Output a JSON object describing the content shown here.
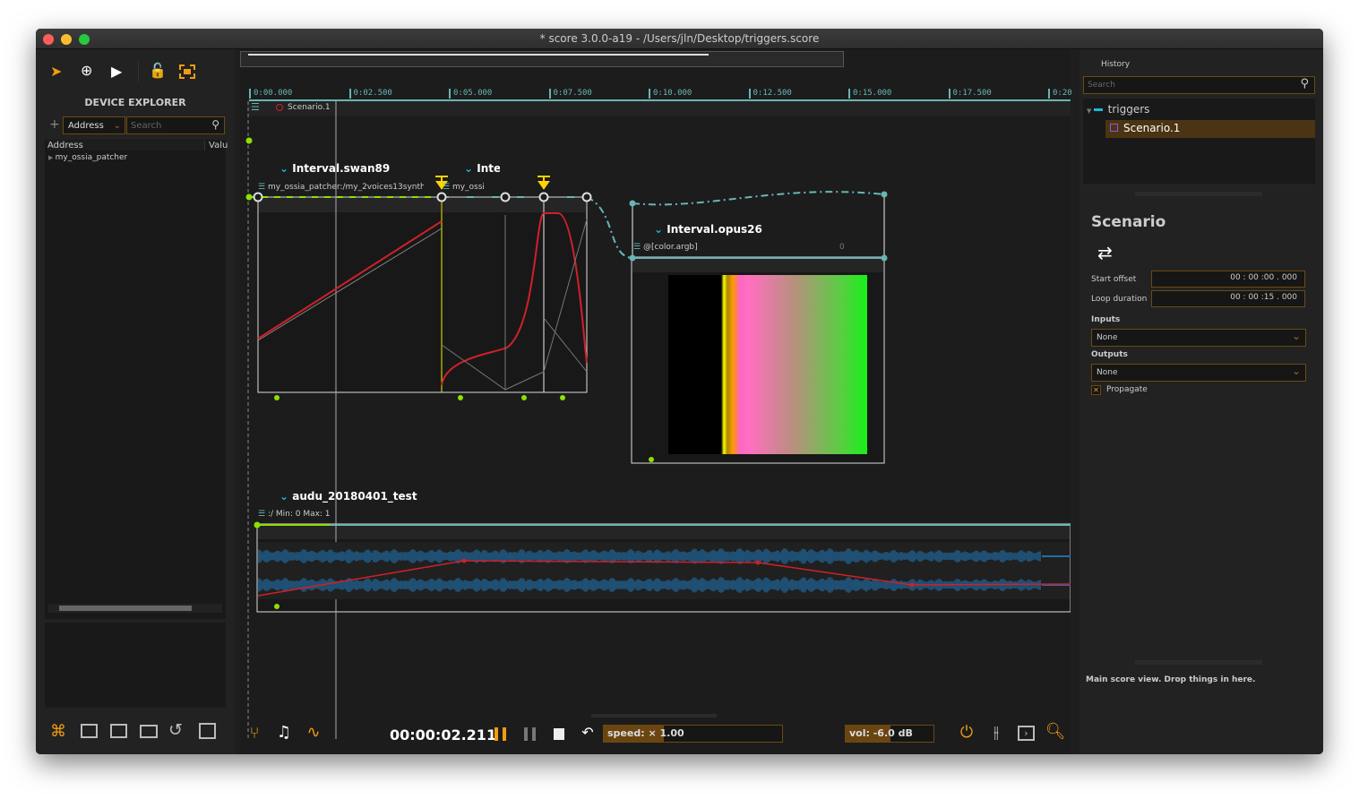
{
  "window": {
    "title": "* score 3.0.0-a19 - /Users/jln/Desktop/triggers.score"
  },
  "left": {
    "toolbar": [
      "select-arrow-icon",
      "add-circle-icon",
      "play-icon",
      "lock-icon",
      "fit-frame-icon"
    ],
    "title": "DEVICE EXPLORER",
    "add": "+",
    "address_select": "Address",
    "search_placeholder": "Search",
    "columns": [
      "Address",
      "Valu"
    ],
    "tree": [
      {
        "label": "my_ossia_patcher"
      }
    ],
    "bottom_icons": [
      "fit-icon",
      "curve-view-icon",
      "device-icon",
      "folder-icon",
      "history-icon",
      "log-icon"
    ]
  },
  "timeline": {
    "ticks": [
      "0:00.000",
      "0:02.500",
      "0:05.000",
      "0:07.500",
      "0:10.000",
      "0:12.500",
      "0:15.000",
      "0:17.500",
      "0:20"
    ],
    "scenario_label": "Scenario.1",
    "intervals": [
      {
        "name": "Interval.swan89",
        "process": "my_ossia_patcher:/my_2voices13synth"
      },
      {
        "name": "Inte",
        "process": "my_ossi"
      },
      {
        "name": "Interval.opus26",
        "process": "@[color.argb]",
        "value": "0"
      },
      {
        "name": "audu_20180401_test",
        "process": ":/ Min: 0 Max: 1"
      }
    ]
  },
  "transport": {
    "time": "00:00:02.211",
    "speed_label": "speed: × 1.00",
    "speed": 1.0,
    "volume_label": "vol: -6.0 dB",
    "volume_db": -6.0
  },
  "right": {
    "history_title": "History",
    "search_placeholder": "Search",
    "tree": {
      "root": "triggers",
      "child": "Scenario.1"
    },
    "inspector": {
      "title": "Scenario",
      "start_offset_label": "Start offset",
      "start_offset": "00 : 00 :00 .   000",
      "loop_duration_label": "Loop duration",
      "loop_duration": "00 : 00 :15 .   000",
      "inputs_label": "Inputs",
      "inputs_value": "None",
      "outputs_label": "Outputs",
      "outputs_value": "None",
      "propagate_label": "Propagate",
      "propagate": true
    },
    "status": "Main score view. Drop things in here."
  },
  "colors": {
    "accent": "#f39c12",
    "teal": "#69b5b5",
    "green": "#8ee000",
    "automation": "#d0202a",
    "waveform": "#1f6fa8"
  }
}
